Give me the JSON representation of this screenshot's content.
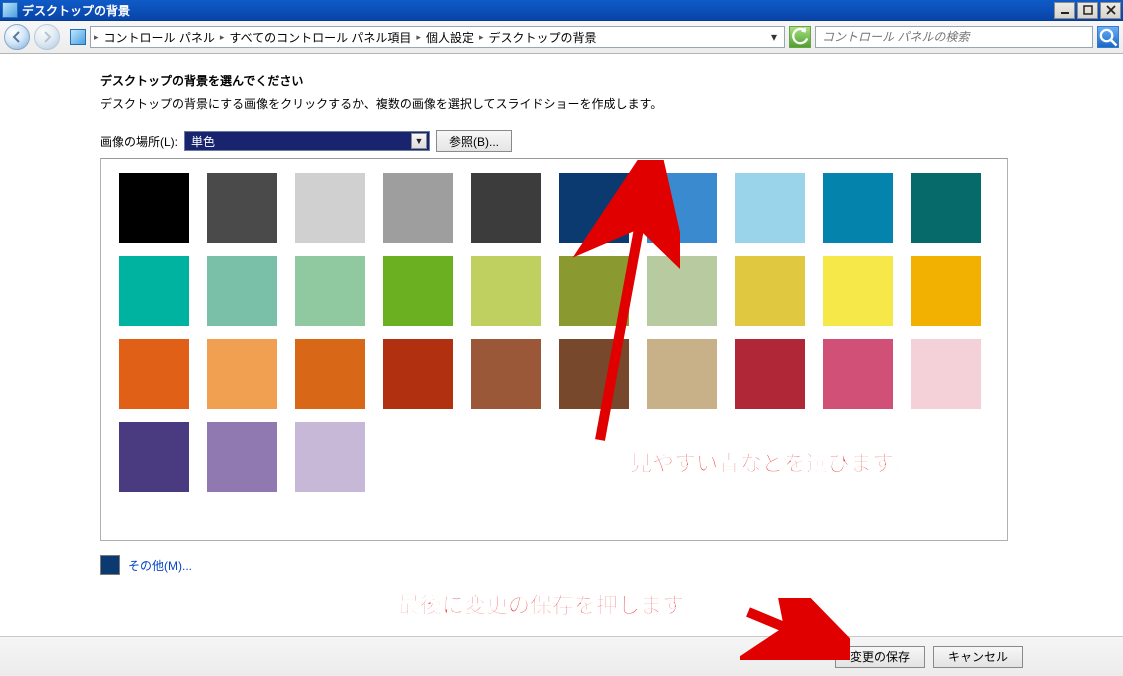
{
  "window": {
    "title": "デスクトップの背景"
  },
  "breadcrumb": {
    "items": [
      "コントロール パネル",
      "すべてのコントロール パネル項目",
      "個人設定",
      "デスクトップの背景"
    ]
  },
  "search": {
    "placeholder": "コントロール パネルの検索"
  },
  "page": {
    "heading": "デスクトップの背景を選んでください",
    "subtext": "デスクトップの背景にする画像をクリックするか、複数の画像を選択してスライドショーを作成します。"
  },
  "location": {
    "label": "画像の場所(L):",
    "value": "単色",
    "browse": "参照(B)..."
  },
  "swatches": [
    "#000000",
    "#4a4a4a",
    "#d0d0d0",
    "#9e9e9e",
    "#3c3c3c",
    "#0a3a70",
    "#3a8ad0",
    "#9ad4ea",
    "#0484ac",
    "#066a6a",
    "#00b2a0",
    "#7ac0a8",
    "#90c8a0",
    "#6ab020",
    "#c0d060",
    "#8a9a30",
    "#b8caa0",
    "#e0c840",
    "#f6e848",
    "#f2b000",
    "#e06018",
    "#f0a050",
    "#d86818",
    "#b03010",
    "#9a5838",
    "#78482c",
    "#c8b088",
    "#b02838",
    "#d05078",
    "#f4d0d8",
    "#4a3a80",
    "#9078b0",
    "#c8b8d8"
  ],
  "other": {
    "label": "その他(M)...",
    "color": "#0a3a70"
  },
  "footer": {
    "save": "変更の保存",
    "cancel": "キャンセル"
  },
  "annotations": {
    "line1": "見やすい青などを選びます。",
    "line2": "最後に変更の保存を押します。"
  }
}
